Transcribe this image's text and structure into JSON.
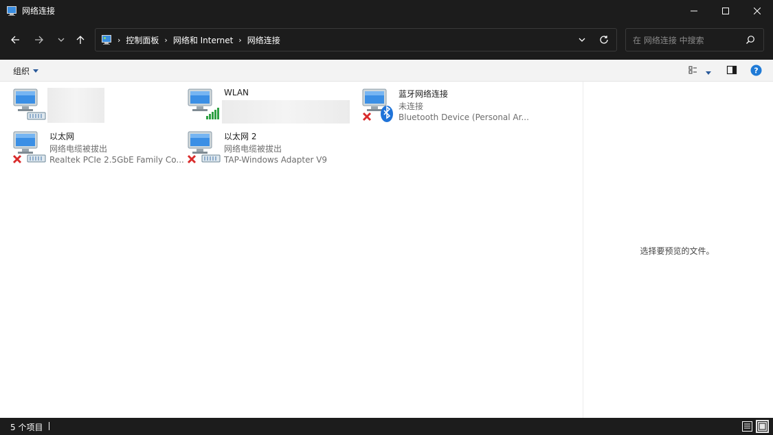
{
  "window": {
    "title": "网络连接",
    "minimize_icon": "minimize-icon",
    "maximize_icon": "maximize-icon",
    "close_icon": "close-icon"
  },
  "nav": {
    "breadcrumb": [
      "控制面板",
      "网络和 Internet",
      "网络连接"
    ],
    "search_placeholder": "在 网络连接 中搜索"
  },
  "commandbar": {
    "organize_label": "组织"
  },
  "connections": [
    {
      "name": "",
      "status": "",
      "device": "",
      "icon": "network-adapter-connected-icon",
      "redacted": true
    },
    {
      "name": "WLAN",
      "status": "",
      "device": "",
      "icon": "wlan-adapter-connected-icon",
      "redacted": true
    },
    {
      "name": "蓝牙网络连接",
      "status": "未连接",
      "device": "Bluetooth Device (Personal Ar...",
      "icon": "bluetooth-adapter-disconnected-icon"
    },
    {
      "name": "以太网",
      "status": "网络电缆被拔出",
      "device": "Realtek PCIe 2.5GbE Family Co...",
      "icon": "ethernet-adapter-unplugged-icon"
    },
    {
      "name": "以太网 2",
      "status": "网络电缆被拔出",
      "device": "TAP-Windows Adapter V9",
      "icon": "ethernet-adapter-unplugged-icon"
    }
  ],
  "preview": {
    "message": "选择要预览的文件。"
  },
  "statusbar": {
    "item_count": "5 个项目"
  },
  "colors": {
    "chrome": "#1c1c1c",
    "content_bg": "#ffffff",
    "accent": "#0078d4",
    "error_red": "#d92b2b",
    "signal_green": "#2ea043"
  }
}
